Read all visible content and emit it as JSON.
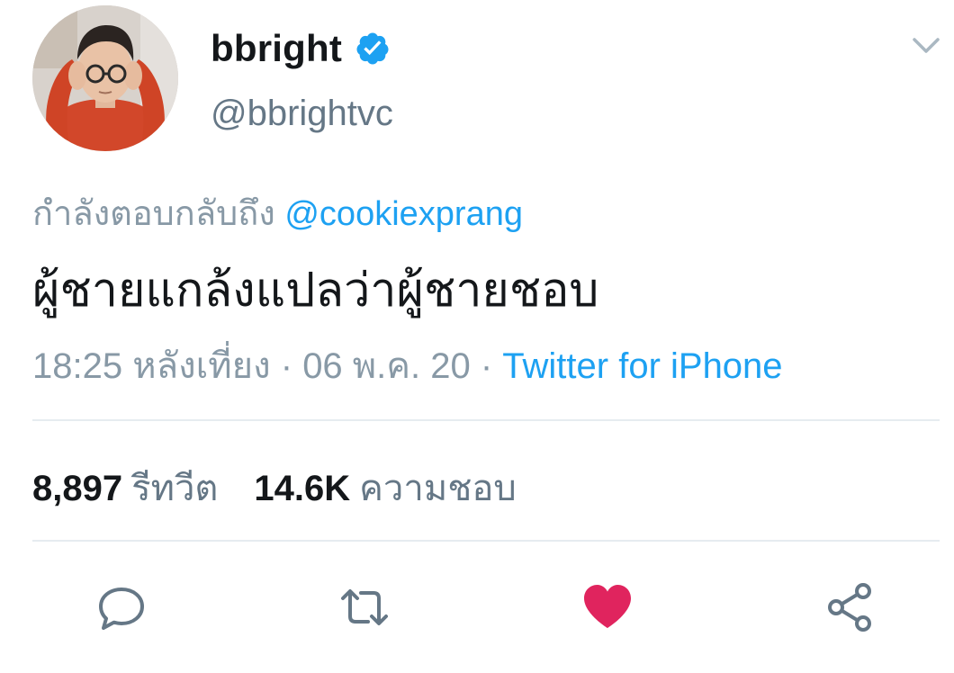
{
  "tweet": {
    "display_name": "bbright",
    "handle": "@bbrightvc",
    "verified": true,
    "reply_prefix": "กำลังตอบกลับถึง",
    "reply_mention": "@cookiexprang",
    "text": "ผู้ชายแกล้งแปลว่าผู้ชายชอบ",
    "time": "18:25 หลังเที่ยง",
    "separator": " · ",
    "date": "06 พ.ค. 20",
    "source": "Twitter for iPhone"
  },
  "stats": {
    "retweets_count": "8,897",
    "retweets_label": "รีทวีต",
    "likes_count": "14.6K",
    "likes_label": "ความชอบ"
  },
  "actions": {
    "reply_icon": "reply-icon",
    "retweet_icon": "retweet-icon",
    "like_icon": "heart-icon",
    "share_icon": "share-icon"
  },
  "colors": {
    "accent": "#1da1f2",
    "like": "#e0245e",
    "muted": "#8899a6",
    "icon": "#657786"
  }
}
